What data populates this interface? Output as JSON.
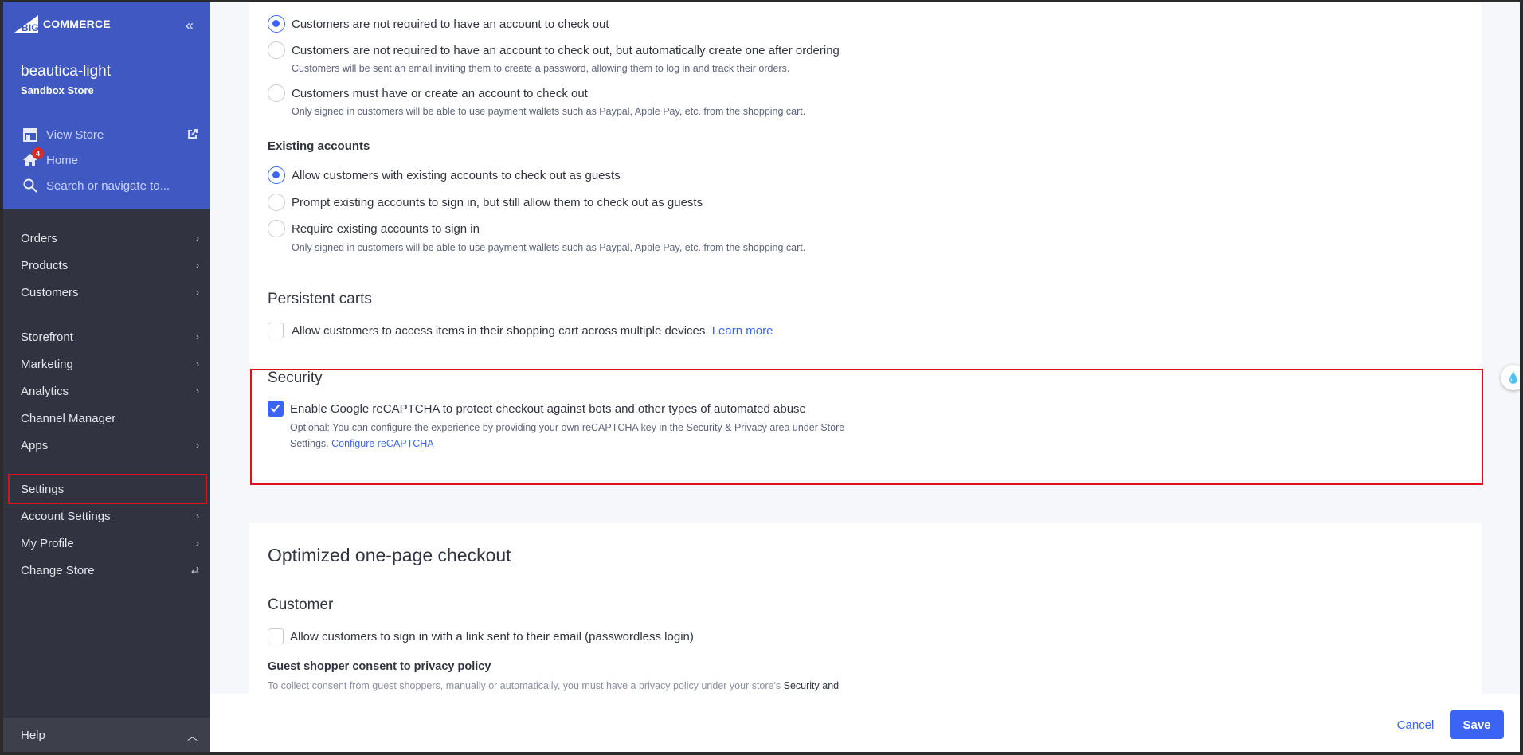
{
  "brand": {
    "logo_text": "COMMERCE",
    "logo_prefix": "BIG"
  },
  "store": {
    "name": "beautica-light",
    "type": "Sandbox Store"
  },
  "quick_links": {
    "view_store": "View Store",
    "home": "Home",
    "home_badge": "4",
    "search_placeholder": "Search or navigate to..."
  },
  "nav": {
    "orders": "Orders",
    "products": "Products",
    "customers": "Customers",
    "storefront": "Storefront",
    "marketing": "Marketing",
    "analytics": "Analytics",
    "channel_manager": "Channel Manager",
    "apps": "Apps",
    "settings": "Settings",
    "account_settings": "Account Settings",
    "my_profile": "My Profile",
    "change_store": "Change Store",
    "help": "Help"
  },
  "guest_checkout": {
    "opt1": "Customers are not required to have an account to check out",
    "opt2": "Customers are not required to have an account to check out, but automatically create one after ordering",
    "opt2_help": "Customers will be sent an email inviting them to create a password, allowing them to log in and track their orders.",
    "opt3": "Customers must have or create an account to check out",
    "opt3_help": "Only signed in customers will be able to use payment wallets such as Paypal, Apple Pay, etc. from the shopping cart.",
    "selected": 1
  },
  "existing_accounts": {
    "heading": "Existing accounts",
    "opt1": "Allow customers with existing accounts to check out as guests",
    "opt2": "Prompt existing accounts to sign in, but still allow them to check out as guests",
    "opt3": "Require existing accounts to sign in",
    "opt3_help": "Only signed in customers will be able to use payment wallets such as Paypal, Apple Pay, etc. from the shopping cart.",
    "selected": 1
  },
  "persistent_carts": {
    "heading": "Persistent carts",
    "label": "Allow customers to access items in their shopping cart across multiple devices.",
    "learn_more": "Learn more",
    "checked": false
  },
  "security": {
    "heading": "Security",
    "label": "Enable Google reCAPTCHA to protect checkout against bots and other types of automated abuse",
    "help_line1": "Optional: You can configure the experience by providing your own reCAPTCHA key in the Security & Privacy area under Store",
    "help_line2": "Settings.",
    "configure_link": "Configure reCAPTCHA",
    "checked": true
  },
  "one_page": {
    "heading": "Optimized one-page checkout",
    "customer_heading": "Customer",
    "passwordless_label": "Allow customers to sign in with a link sent to their email (passwordless login)",
    "passwordless_checked": false,
    "consent_heading": "Guest shopper consent to privacy policy",
    "consent_help": "To collect consent from guest shoppers, manually or automatically, you must have a privacy policy under your store's",
    "consent_link": "Security and"
  },
  "footer": {
    "cancel": "Cancel",
    "save": "Save"
  },
  "colors": {
    "accent": "#3c64f4",
    "sidebar_top": "#3f58c2",
    "sidebar": "#313440",
    "highlight": "#e0101a"
  }
}
